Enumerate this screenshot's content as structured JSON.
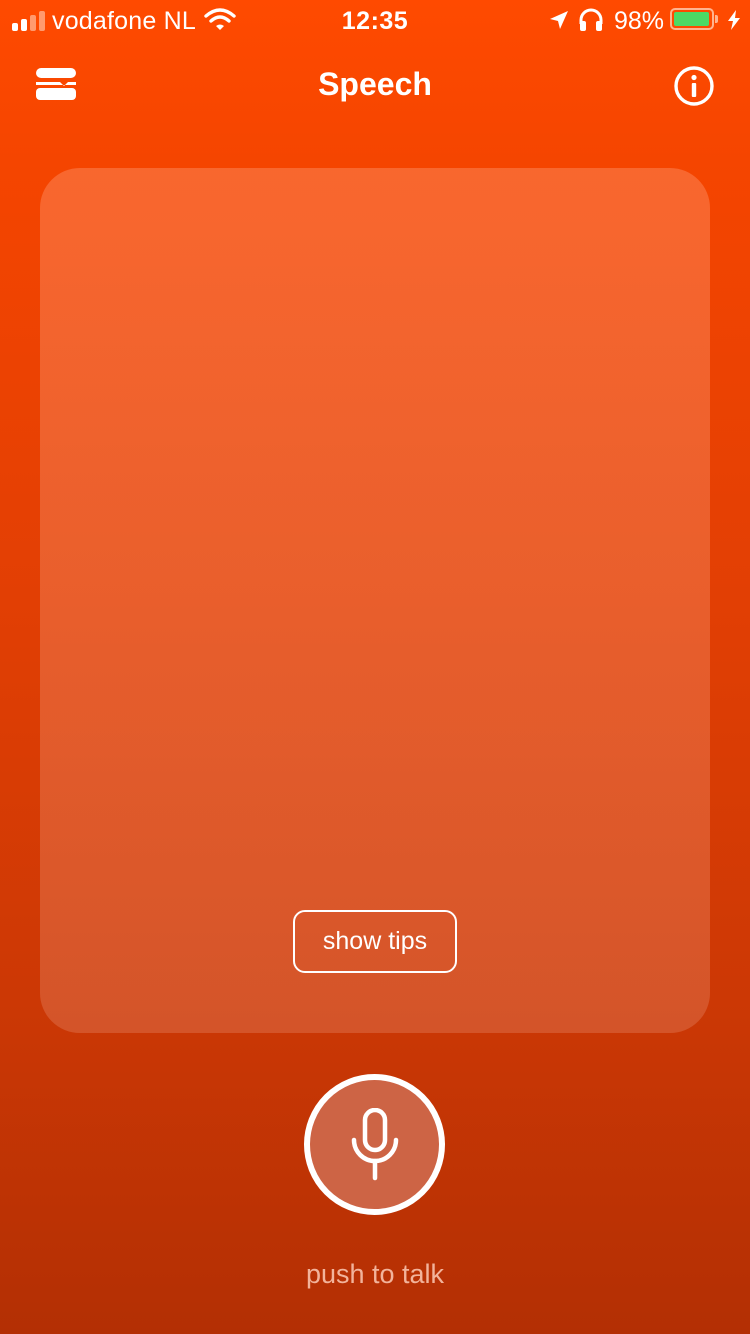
{
  "status_bar": {
    "carrier": "vodafone NL",
    "time": "12:35",
    "battery_percent": "98%",
    "signal_bars_filled": 2,
    "signal_bars_total": 4,
    "battery_level": 0.98,
    "battery_color": "#4cd964",
    "icons": [
      "wifi-icon",
      "location-arrow-icon",
      "headphones-icon",
      "battery-icon",
      "charging-bolt-icon"
    ]
  },
  "nav": {
    "title": "Speech",
    "left_icon": "menu-icon",
    "right_icon": "info-icon"
  },
  "transcript": {
    "tips_button_label": "show tips"
  },
  "mic": {
    "icon": "microphone-icon",
    "label": "push to talk"
  },
  "colors": {
    "background_top": "#ff4a00",
    "background_bottom": "#b32f04",
    "mic_fill": "#cd6445",
    "label_color": "#f2b39b"
  }
}
